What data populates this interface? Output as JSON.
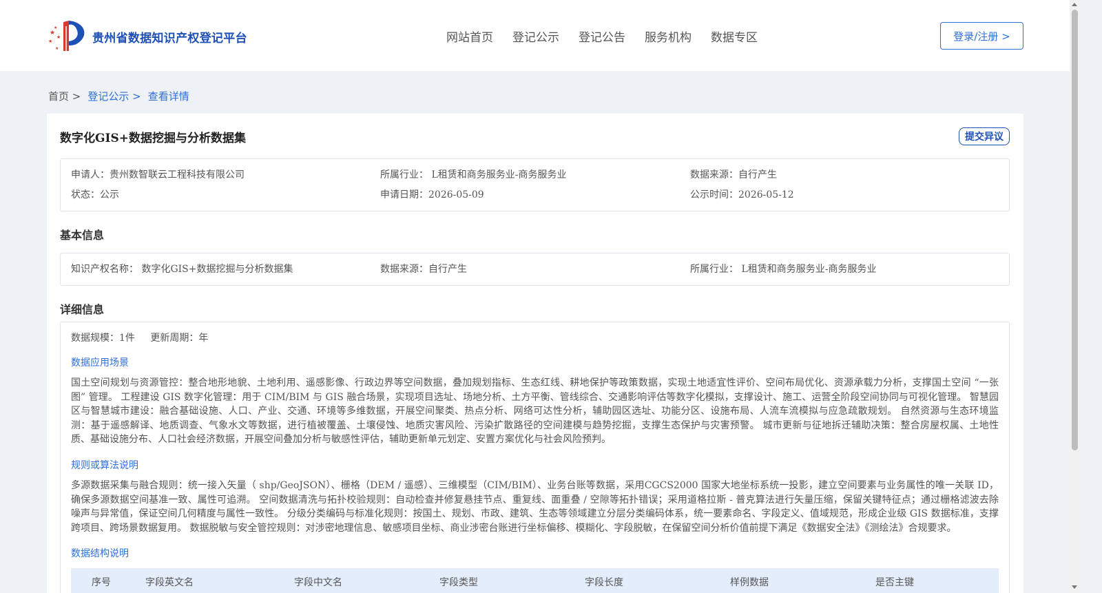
{
  "header": {
    "logo_text": "贵州省数据知识产权登记平台",
    "nav": [
      "网站首页",
      "登记公示",
      "登记公告",
      "服务机构",
      "数据专区"
    ],
    "login_label": "登录/注册 >"
  },
  "breadcrumb": {
    "home": "首页 >",
    "items": [
      "登记公示 >",
      "查看详情"
    ]
  },
  "record": {
    "title": "数字化GIS+数据挖掘与分析数据集",
    "objection_label": "提交异议",
    "summary": [
      "申请人：贵州数智联云工程科技有限公司",
      "所属行业： L租赁和商务服务业-商务服务业",
      "数据来源：自行产生",
      "状态：公示",
      "申请日期：2026-05-09",
      "公示时间：2026-05-12"
    ]
  },
  "basic": {
    "heading": "基本信息",
    "cells": [
      "知识产权名称： 数字化GIS+数据挖掘与分析数据集",
      "数据来源：自行产生",
      "所属行业： L租赁和商务服务业-商务服务业"
    ]
  },
  "detail": {
    "heading": "详细信息",
    "scale": "数据规模：1件",
    "cycle": "更新周期：年",
    "scenario_title": "数据应用场景",
    "scenario_text": "国土空间规划与资源管控：整合地形地貌、土地利用、遥感影像、行政边界等空间数据，叠加规划指标、生态红线、耕地保护等政策数据，实现土地适宜性评价、空间布局优化、资源承载力分析，支撑国土空间 “一张图” 管理。 工程建设 GIS 数字化管理：用于 CIM/BIM 与 GIS 融合场景，实现项目选址、场地分析、土方平衡、管线综合、交通影响评估等数字化模拟，支撑设计、施工、运营全阶段空间协同与可视化管理。 智慧园区与智慧城市建设：融合基础设施、人口、产业、交通、环境等多维数据，开展空间聚类、热点分析、网络可达性分析，辅助园区选址、功能分区、设施布局、人流车流模拟与应急疏散规划。 自然资源与生态环境监测：基于遥感解译、地质调查、气象水文等数据，进行植被覆盖、土壤侵蚀、地质灾害风险、污染扩散路径的空间建模与趋势挖掘，支撑生态保护与灾害预警。 城市更新与征地拆迁辅助决策：整合房屋权属、土地性质、基础设施分布、人口社会经济数据，开展空间叠加分析与敏感性评估，辅助更新单元划定、安置方案优化与社会风险预判。",
    "rules_title": "规则或算法说明",
    "rules_text": "多源数据采集与融合规则：统一接入矢量（ shp/GeoJSON）、栅格（DEM / 遥感）、三维模型（CIM/BIM）、业务台账等数据，采用CGCS2000 国家大地坐标系统一投影，建立空间要素与业务属性的唯一关联 ID，确保多源数据空间基准一致、属性可追溯。 空间数据清洗与拓扑校验规则：自动检查并修复悬挂节点、重复线、面重叠 / 空隙等拓扑错误；采用道格拉斯 - 普克算法进行矢量压缩，保留关键特征点；通过栅格滤波去除噪声与异常值，保证空间几何精度与属性一致性。 分级分类编码与标准化规则：按国土、规划、市政、建筑、生态等领域建立分层分类编码体系，统一要素命名、字段定义、值域规范，形成企业级 GIS 数据标准，支撑跨项目、跨场景数据复用。 数据脱敏与安全管控规则：对涉密地理信息、敏感项目坐标、商业涉密台账进行坐标偏移、模糊化、字段脱敏，在保留空间分析价值前提下满足《数据安全法》《测绘法》合规要求。",
    "structure_title": "数据结构说明",
    "table_headers": [
      "序号",
      "字段英文名",
      "字段中文名",
      "字段类型",
      "字段长度",
      "样例数据",
      "是否主键"
    ]
  },
  "colors": {
    "brand": "#1d4fb6",
    "link": "#2f6fd6",
    "table_header_bg": "#e4edfb",
    "page_bg": "#eef1f5"
  }
}
